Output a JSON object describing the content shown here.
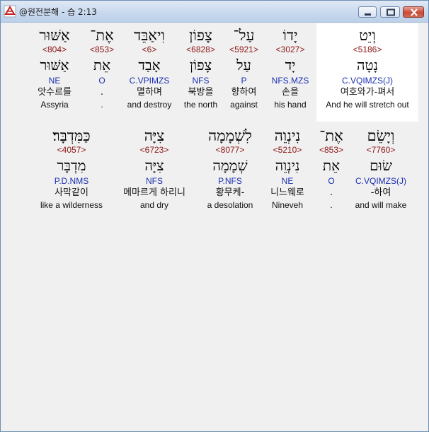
{
  "window": {
    "title": "@원전분해 - 습 2:13",
    "icon": "app-icon"
  },
  "rows": [
    {
      "words": [
        {
          "hebrew": "וְיֵט",
          "strong": "<5186>",
          "lemma": "נָטָה",
          "morph": "C.VQIMZS(J)",
          "korean": "여호와가-펴서",
          "english": "And he will stretch out",
          "highlighted": true
        },
        {
          "hebrew": "יָדוֹ",
          "strong": "<3027>",
          "lemma": "יָד",
          "morph": "NFS.MZS",
          "korean": "손을",
          "english": "his hand"
        },
        {
          "hebrew": "עַל־",
          "strong": "<5921>",
          "lemma": "עַל",
          "morph": "P",
          "korean": "향하여",
          "english": "against"
        },
        {
          "hebrew": "צָפוֹן",
          "strong": "<6828>",
          "lemma": "צָפוֹן",
          "morph": "NFS",
          "korean": "북방을",
          "english": "the north"
        },
        {
          "hebrew": "וִיאַבֵּד",
          "strong": "<6>",
          "lemma": "אָבַד",
          "morph": "C.VPIMZS",
          "korean": "멸하며",
          "english": "and destroy"
        },
        {
          "hebrew": "אֶת־",
          "strong": "<853>",
          "lemma": "אֵת",
          "morph": "O",
          "korean": ".",
          "english": "."
        },
        {
          "hebrew": "אַשּׁוּר",
          "strong": "<804>",
          "lemma": "אַשּׁוּר",
          "morph": "NE",
          "korean": "앗수르를",
          "english": "Assyria"
        }
      ]
    },
    {
      "words": [
        {
          "hebrew": "וְיָשֵׂם",
          "strong": "<7760>",
          "lemma": "שׂוּם",
          "morph": "C.VQIMZS(J)",
          "korean": "-하여",
          "english": "and will make"
        },
        {
          "hebrew": "אֶת־",
          "strong": "<853>",
          "lemma": "אֵת",
          "morph": "O",
          "korean": ".",
          "english": "."
        },
        {
          "hebrew": "נִינְוֵה",
          "strong": "<5210>",
          "lemma": "נִינְוֵה",
          "morph": "NE",
          "korean": "니느웨로",
          "english": "Nineveh"
        },
        {
          "hebrew": "לִשְׁמָמָה",
          "strong": "<8077>",
          "lemma": "שְׁמָמָה",
          "morph": "P.NFS",
          "korean": "황무케-",
          "english": "a desolation"
        },
        {
          "hebrew": "צִיָּה",
          "strong": "<6723>",
          "lemma": "צִיָּה",
          "morph": "NFS",
          "korean": "메마르게 하리니",
          "english": "and dry"
        },
        {
          "hebrew": "כַּמִּדְבָּר׃",
          "strong": "<4057>",
          "lemma": "מִדְבָּר",
          "morph": "P.D.NMS",
          "korean": "사막같이",
          "english": "like a wilderness"
        }
      ]
    }
  ]
}
